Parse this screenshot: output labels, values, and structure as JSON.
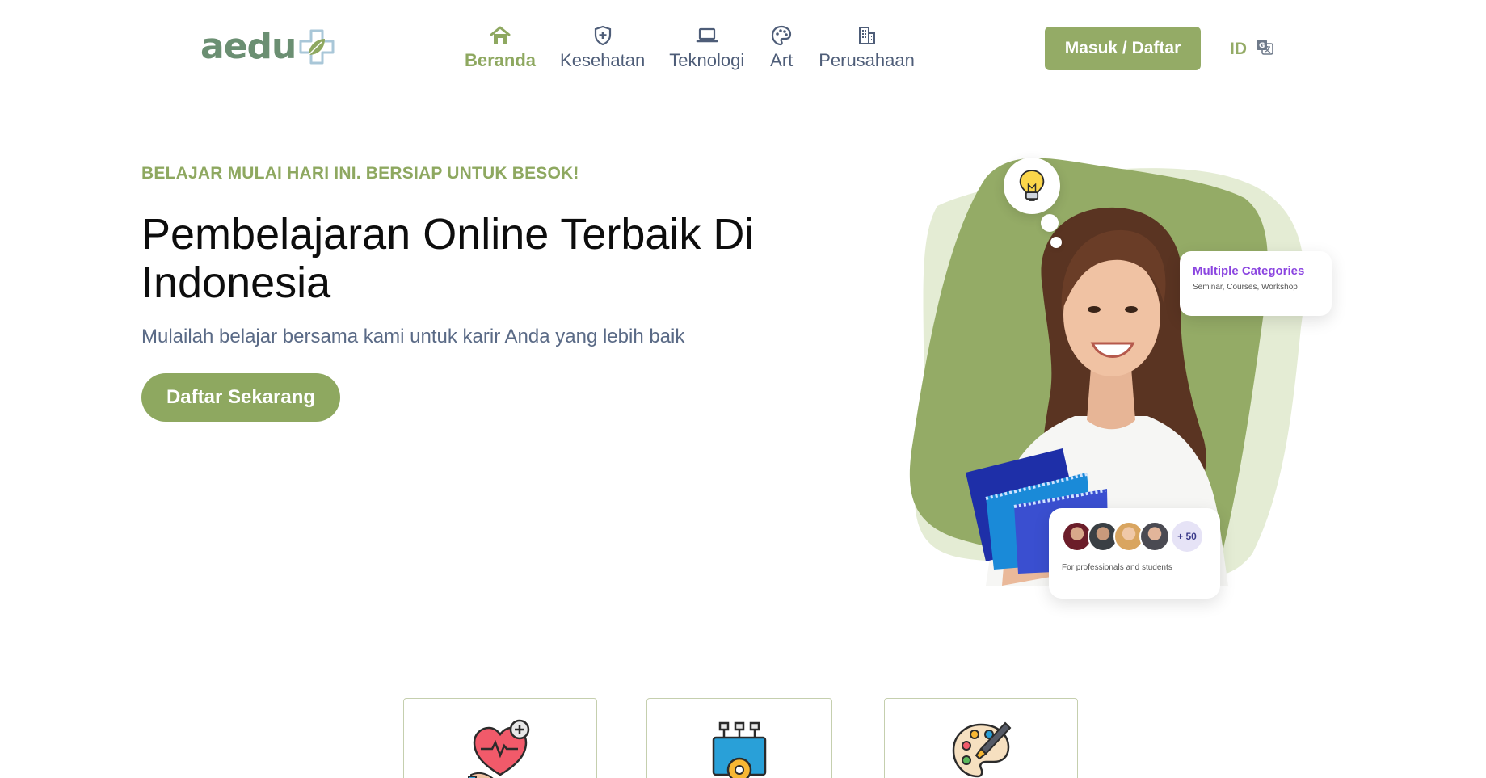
{
  "header": {
    "logo_text": "aedu",
    "nav": [
      {
        "label": "Beranda",
        "icon": "home-icon",
        "active": true
      },
      {
        "label": "Kesehatan",
        "icon": "shield-plus-icon",
        "active": false
      },
      {
        "label": "Teknologi",
        "icon": "laptop-icon",
        "active": false
      },
      {
        "label": "Art",
        "icon": "palette-icon",
        "active": false
      },
      {
        "label": "Perusahaan",
        "icon": "building-icon",
        "active": false
      }
    ],
    "login_label": "Masuk / Daftar",
    "language_code": "ID",
    "language_icon": "translate-icon"
  },
  "hero": {
    "eyebrow": "BELAJAR MULAI HARI INI. BERSIAP UNTUK BESOK!",
    "title": "Pembelajaran Online Terbaik Di Indonesia",
    "subtitle": "Mulailah belajar bersama kami untuk karir Anda yang lebih baik",
    "cta_label": "Daftar Sekarang"
  },
  "hero_art": {
    "categories_title": "Multiple Categories",
    "categories_sub": "Seminar, Courses, Workshop",
    "people_count": "+ 50",
    "people_caption": "For professionals  and students"
  },
  "categories": [
    {
      "icon": "heart-health-icon"
    },
    {
      "icon": "tech-laptop-icon"
    },
    {
      "icon": "art-palette-icon"
    }
  ],
  "colors": {
    "brand_green": "#94ab66",
    "nav_text": "#4e5d78",
    "accent_purple": "#8b45e0"
  }
}
